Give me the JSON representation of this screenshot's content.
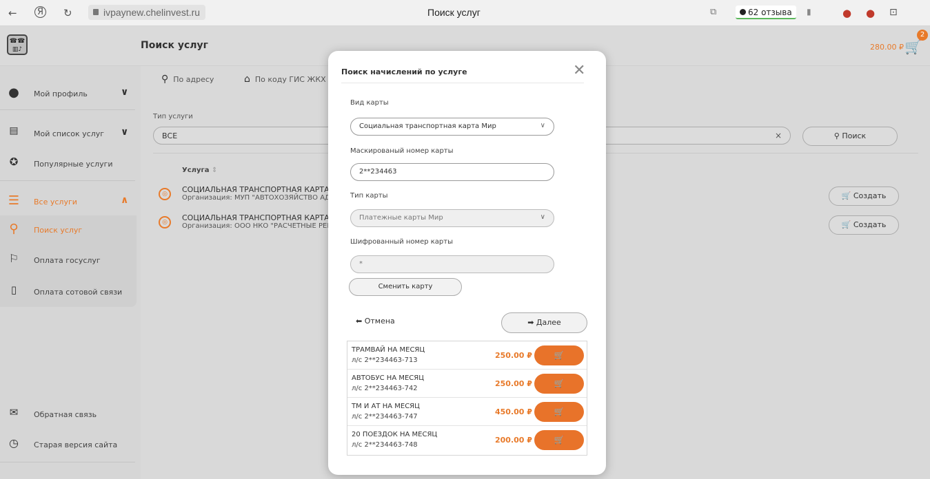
{
  "browser": {
    "back": "←",
    "yandex": "Я",
    "reload": "↻",
    "url": "ivpaynew.chelinvest.ru",
    "tab_title": "Поиск услуг",
    "reviews": "62 отзыва"
  },
  "header": {
    "page_title": "Поиск услуг",
    "cart_total": "280.00 ₽",
    "cart_count": "2"
  },
  "sidebar": {
    "items": [
      {
        "label": "Мой профиль",
        "icon": "user-icon"
      },
      {
        "label": "Мой список услуг",
        "icon": "id-card-icon"
      },
      {
        "label": "Популярные услуги",
        "icon": "award-icon"
      },
      {
        "label": "Все услуги",
        "icon": "list-icon"
      },
      {
        "label": "Поиск услуг",
        "icon": "search-icon"
      },
      {
        "label": "Оплата госуслуг",
        "icon": "flag-icon"
      },
      {
        "label": "Оплата сотовой связи",
        "icon": "phone-icon"
      },
      {
        "label": "Обратная связь",
        "icon": "envelope-icon"
      },
      {
        "label": "Старая версия сайта",
        "icon": "history-icon"
      }
    ]
  },
  "main": {
    "tab_address": "По адресу",
    "tab_gis": "По коду ГИС ЖКХ",
    "type_label": "Тип услуги",
    "type_value": "ВСЕ",
    "clear": "×",
    "search_button": "Поиск",
    "column_service": "Услуга",
    "services": [
      {
        "title": "СОЦИАЛЬНАЯ ТРАНСПОРТНАЯ КАРТА М",
        "org": "Организация: МУП \"АВТОХОЗЯЙСТВО АДМ",
        "button": "Создать"
      },
      {
        "title": "СОЦИАЛЬНАЯ ТРАНСПОРТНАЯ КАРТА М",
        "org": "Организация: ООО НКО \"РАСЧЕТНЫЕ РЕШ",
        "button": "Создать"
      }
    ]
  },
  "modal": {
    "title": "Поиск начислений по услуге",
    "card_kind_label": "Вид карты",
    "card_kind_value": "Социальная транспортная карта Мир",
    "masked_label": "Маскированый номер карты",
    "masked_value": "2**234463",
    "card_type_label": "Тип карты",
    "card_type_value": "Платежные карты Мир",
    "encrypted_label": "Шифрованный номер карты",
    "encrypted_value": "*",
    "change_card": "Сменить карту",
    "cancel": "Отмена",
    "next": "Далее",
    "results": [
      {
        "name": "ТРАМВАЙ НА МЕСЯЦ",
        "account": "л/с 2**234463-713",
        "price": "250.00 ₽"
      },
      {
        "name": "АВТОБУС НА МЕСЯЦ",
        "account": "л/с 2**234463-742",
        "price": "250.00 ₽"
      },
      {
        "name": "ТМ И АТ НА МЕСЯЦ",
        "account": "л/с 2**234463-747",
        "price": "450.00 ₽"
      },
      {
        "name": "20 ПОЕЗДОК НА МЕСЯЦ",
        "account": "л/с 2**234463-748",
        "price": "200.00 ₽"
      }
    ]
  },
  "colors": {
    "accent": "#e87a2a"
  }
}
